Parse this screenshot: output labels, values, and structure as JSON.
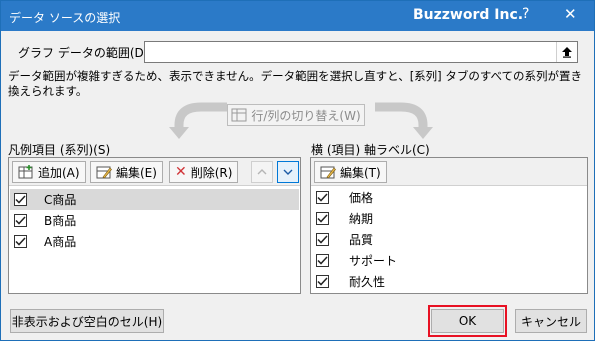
{
  "window": {
    "title": "データ ソースの選択",
    "brand": "Buzzword Inc.",
    "help": "?",
    "close": "✕"
  },
  "range": {
    "label": "グラフ データの範囲(D):",
    "value": ""
  },
  "message": "データ範囲が複雑すぎるため、表示できません。データ範囲を選択し直すと、[系列] タブのすべての系列が置き換えられます。",
  "switch_button": "行/列の切り替え(W)",
  "legend_section": {
    "label": "凡例項目 (系列)(S)",
    "add": "追加(A)",
    "edit": "編集(E)",
    "delete": "削除(R)",
    "items": [
      {
        "label": "C商品",
        "checked": true,
        "selected": true
      },
      {
        "label": "B商品",
        "checked": true,
        "selected": false
      },
      {
        "label": "A商品",
        "checked": true,
        "selected": false
      }
    ]
  },
  "axis_section": {
    "label": "横 (項目) 軸ラベル(C)",
    "edit": "編集(T)",
    "items": [
      {
        "label": "価格",
        "checked": true
      },
      {
        "label": "納期",
        "checked": true
      },
      {
        "label": "品質",
        "checked": true
      },
      {
        "label": "サポート",
        "checked": true
      },
      {
        "label": "耐久性",
        "checked": true
      }
    ]
  },
  "footer": {
    "hidden_cells": "非表示および空白のセル(H)",
    "ok": "OK",
    "cancel": "キャンセル"
  },
  "colors": {
    "titlebar": "#2b7ac8",
    "ok_highlight": "#e81123",
    "focus": "#0078d7"
  }
}
